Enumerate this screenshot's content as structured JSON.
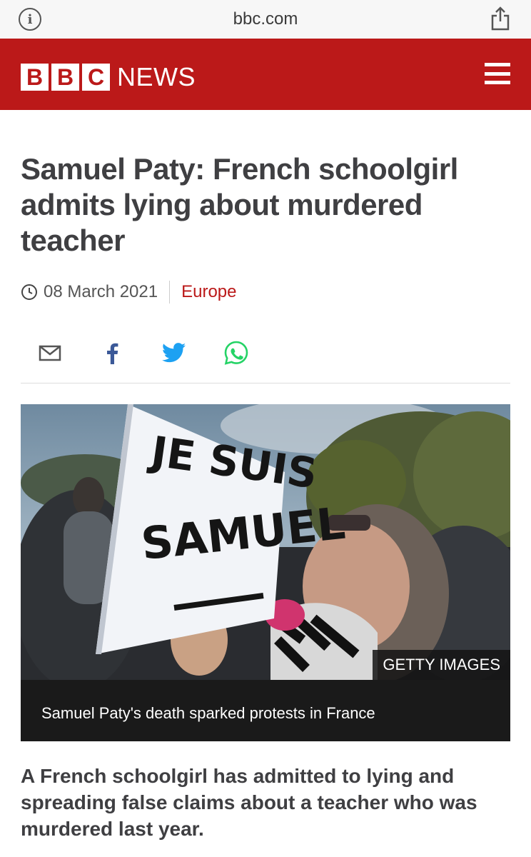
{
  "browser": {
    "url": "bbc.com",
    "info_icon": "info-icon",
    "share_icon": "share-icon"
  },
  "header": {
    "logo_letters": [
      "B",
      "B",
      "C"
    ],
    "logo_word": "NEWS",
    "menu_icon": "hamburger-menu-icon",
    "brand_color": "#bb1919"
  },
  "article": {
    "headline": "Samuel Paty: French schoolgirl admits lying about murdered teacher",
    "date": "08 March 2021",
    "section": "Europe",
    "share_icons": [
      "email-icon",
      "facebook-icon",
      "twitter-icon",
      "whatsapp-icon"
    ],
    "image": {
      "sign_text_line1": "JE SUIS",
      "sign_text_line2": "SAMUEL",
      "credit": "GETTY IMAGES",
      "caption": "Samuel Paty's death sparked protests in France"
    },
    "intro": "A French schoolgirl has admitted to lying and spreading false claims about a teacher who was murdered last year."
  }
}
